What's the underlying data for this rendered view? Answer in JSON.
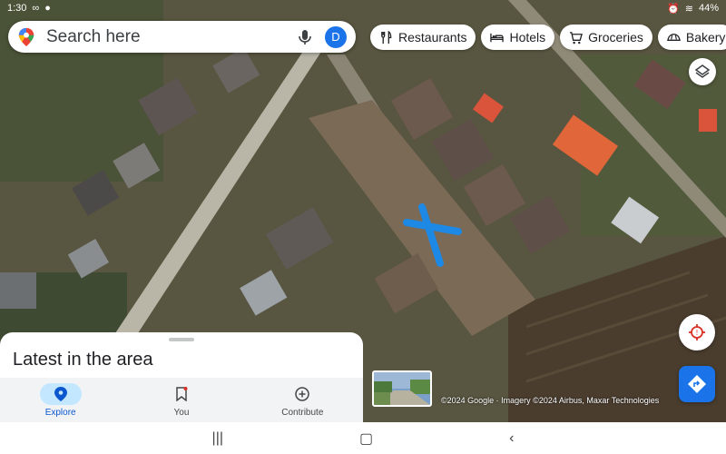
{
  "status_bar": {
    "time": "1:30",
    "battery": "44%"
  },
  "search": {
    "placeholder": "Search here",
    "avatar_letter": "D"
  },
  "chips": [
    {
      "label": "Restaurants",
      "icon": "fork-knife-icon"
    },
    {
      "label": "Hotels",
      "icon": "bed-icon"
    },
    {
      "label": "Groceries",
      "icon": "cart-icon"
    },
    {
      "label": "Bakery",
      "icon": "bakery-icon"
    }
  ],
  "map": {
    "marker": "blue-x-marker"
  },
  "copyright": "©2024 Google · Imagery ©2024 Airbus, Maxar Technologies",
  "sheet": {
    "title": "Latest in the area"
  },
  "bottom_tabs": [
    {
      "label": "Explore",
      "icon": "location-pin-icon",
      "active": true
    },
    {
      "label": "You",
      "icon": "bookmark-icon",
      "active": false
    },
    {
      "label": "Contribute",
      "icon": "add-circle-icon",
      "active": false
    }
  ],
  "colors": {
    "accent": "#1a73e8",
    "active_tab_bg": "#c2e7ff",
    "marker": "#1e88e5"
  }
}
